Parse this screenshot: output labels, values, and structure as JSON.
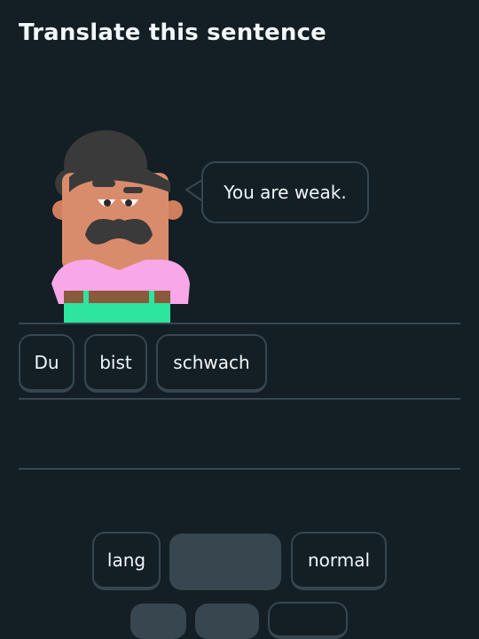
{
  "header": {
    "title": "Translate this sentence"
  },
  "prompt": {
    "sentence": "You are weak."
  },
  "answer": {
    "words": [
      "Du",
      "bist",
      "schwach"
    ]
  },
  "word_bank": {
    "words": [
      "lang",
      "",
      "normal"
    ]
  },
  "colors": {
    "background": "#131f24",
    "border": "#37464f",
    "text": "#f1f7fb",
    "shirt": "#f8a8e8",
    "pants": "#2ee59d",
    "skin": "#d98c6c",
    "hair": "#3b3b3b"
  }
}
